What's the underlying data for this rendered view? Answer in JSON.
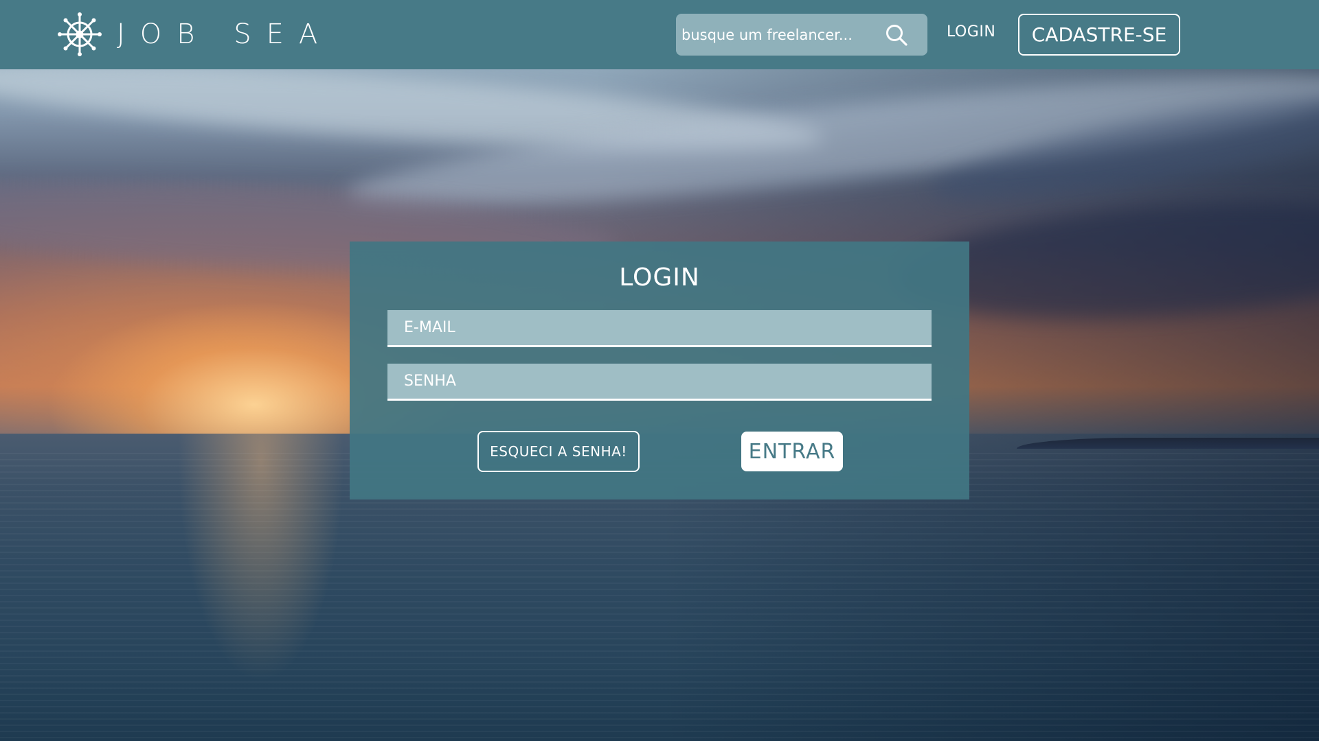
{
  "header": {
    "brand": "JOB SEA",
    "logo_icon": "ship-wheel-icon",
    "search": {
      "placeholder": "busque um freelancer...",
      "value": "",
      "icon": "search-icon"
    },
    "login_link": "LOGIN",
    "signup_label": "CADASTRE-SE"
  },
  "login": {
    "title": "LOGIN",
    "email_placeholder": "E-MAIL",
    "email_value": "",
    "password_placeholder": "SENHA",
    "password_value": "",
    "forgot_label": "ESQUECI A SENHA!",
    "submit_label": "ENTRAR"
  },
  "colors": {
    "header_bg": "#477a87",
    "card_bg": "#427683",
    "field_bg": "#9fbec5",
    "search_bg": "#8fb1ba",
    "accent_text": "#477a87",
    "white": "#ffffff"
  }
}
